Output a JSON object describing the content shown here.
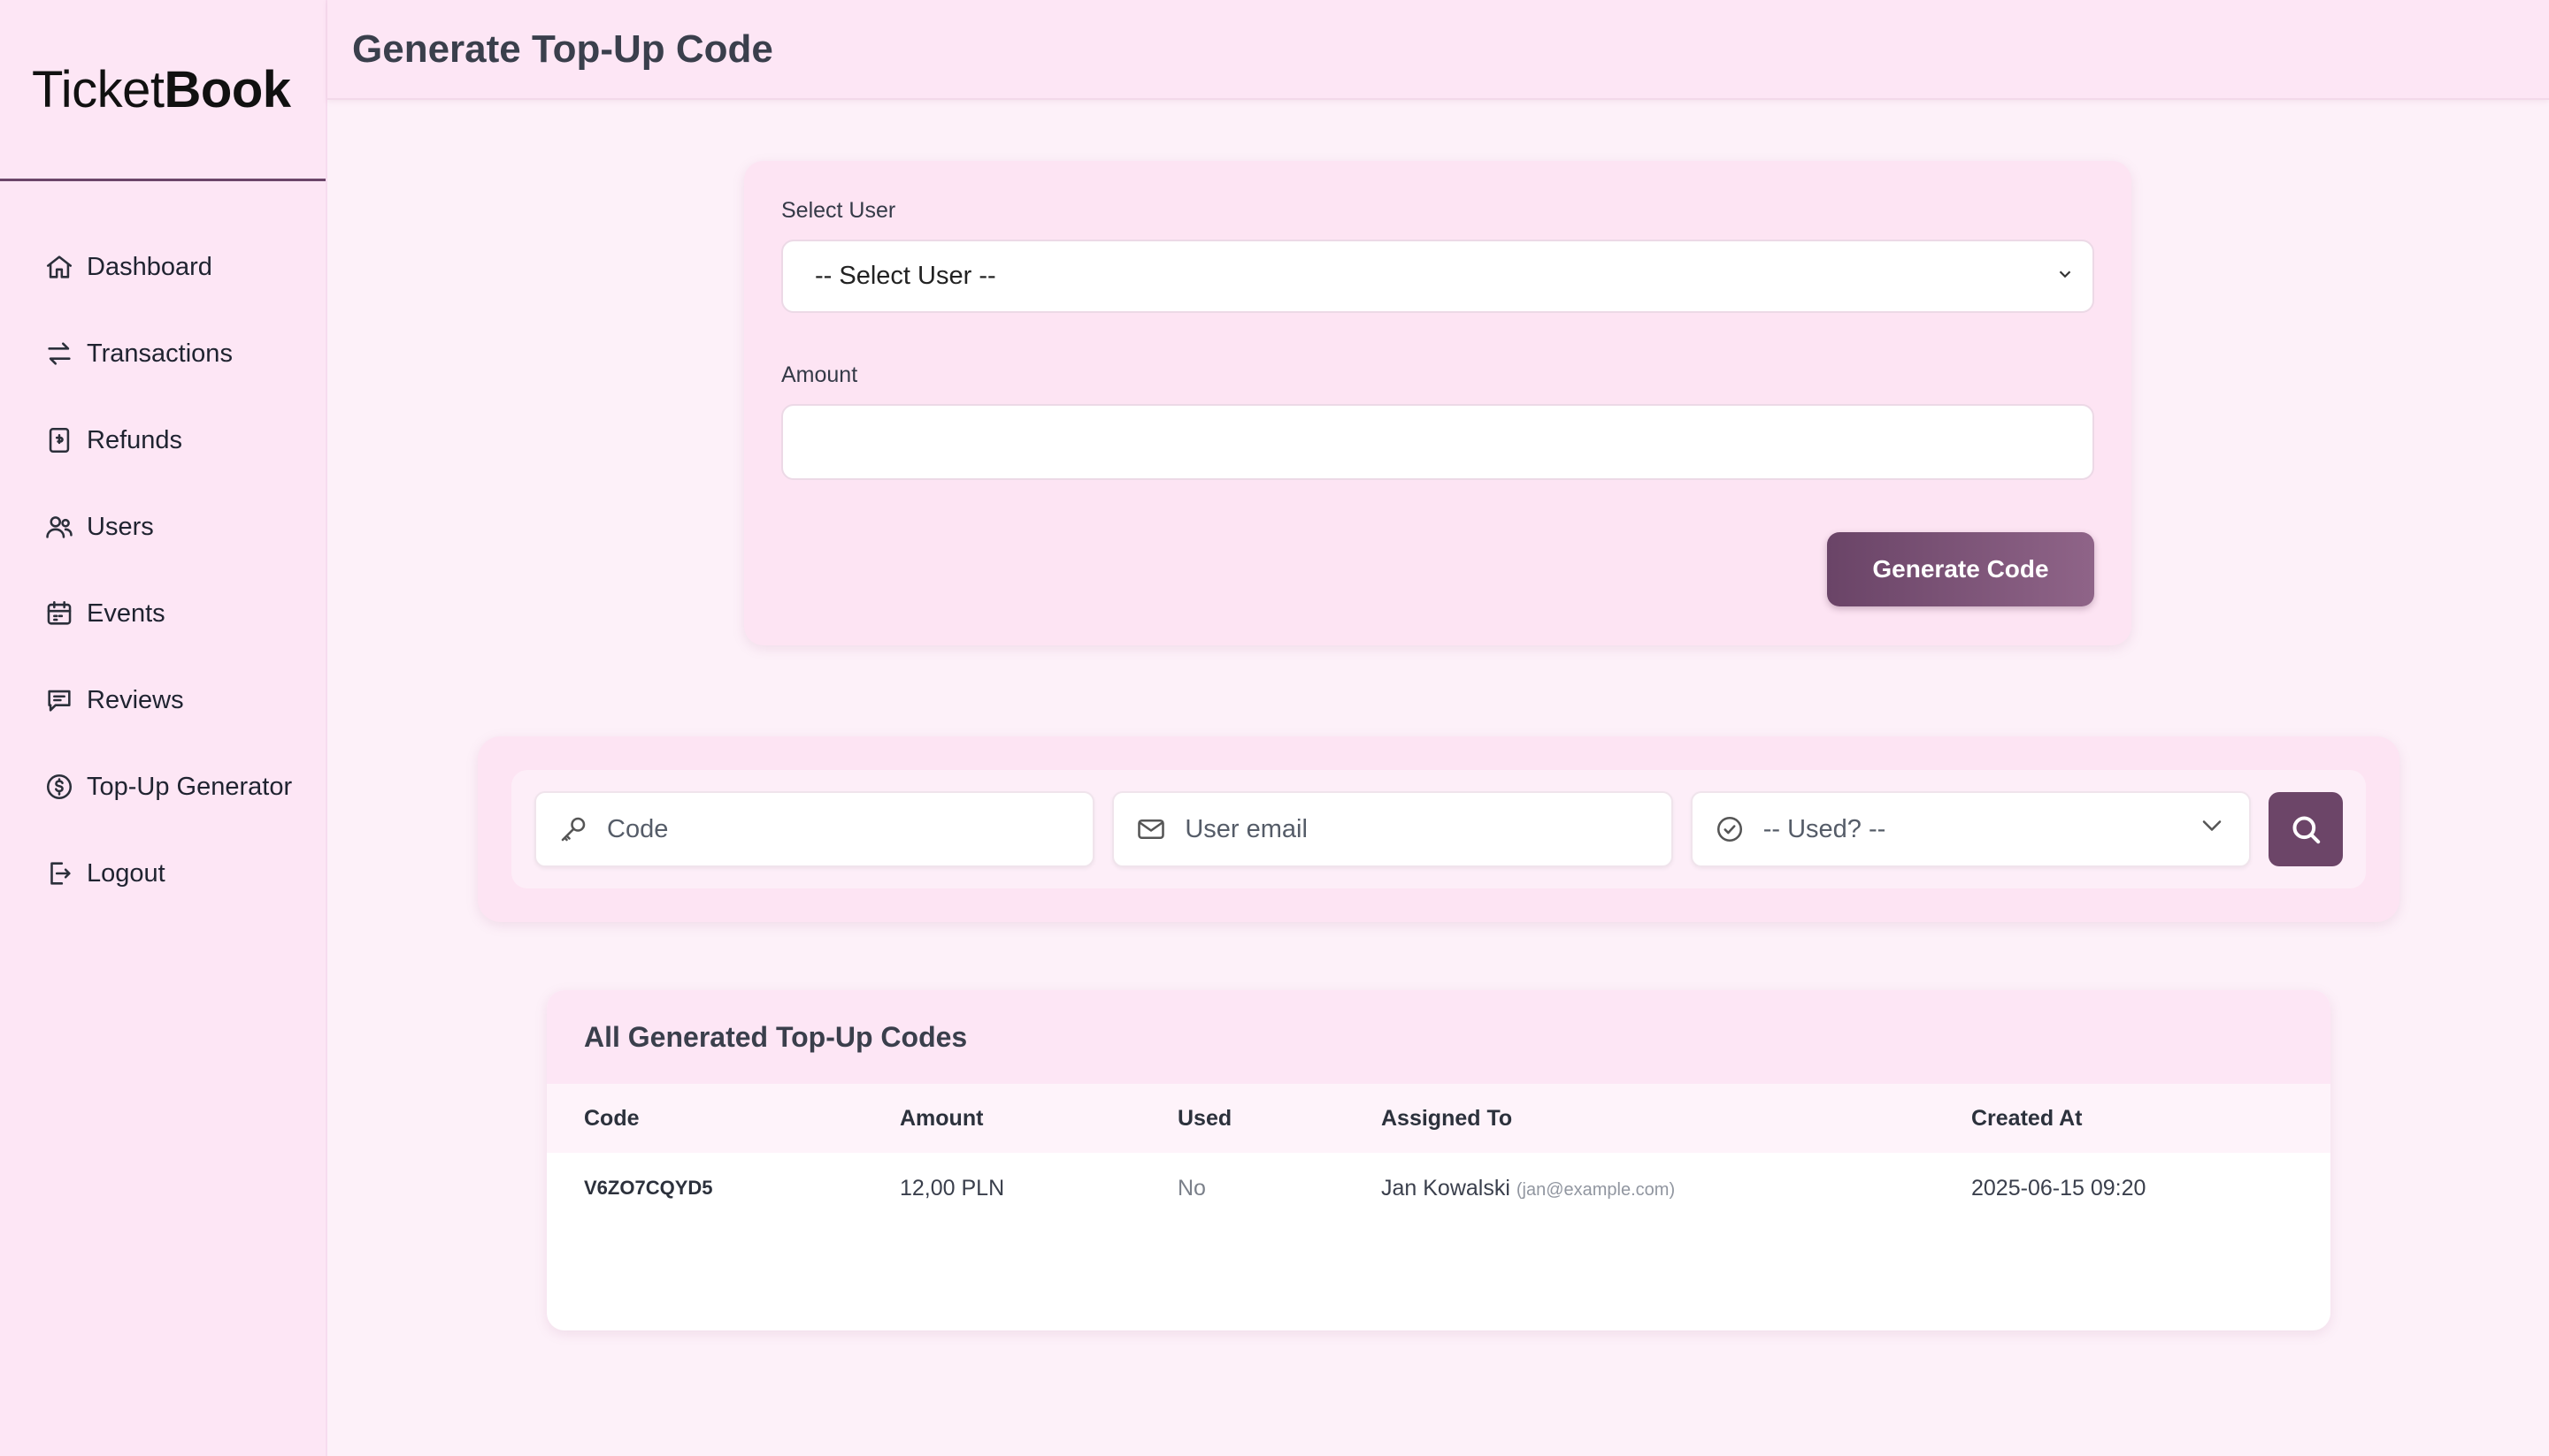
{
  "brand": {
    "light": "Ticket",
    "bold": "Book"
  },
  "sidebar": {
    "items": [
      {
        "label": "Dashboard",
        "icon": "home-icon"
      },
      {
        "label": "Transactions",
        "icon": "arrows-icon"
      },
      {
        "label": "Refunds",
        "icon": "receipt-icon"
      },
      {
        "label": "Users",
        "icon": "users-icon"
      },
      {
        "label": "Events",
        "icon": "calendar-icon"
      },
      {
        "label": "Reviews",
        "icon": "chat-icon"
      },
      {
        "label": "Top-Up Generator",
        "icon": "dollar-icon"
      },
      {
        "label": "Logout",
        "icon": "logout-icon"
      }
    ]
  },
  "header": {
    "title": "Generate Top-Up Code"
  },
  "form": {
    "user_label": "Select User",
    "user_value": "-- Select User --",
    "amount_label": "Amount",
    "amount_value": "",
    "generate_label": "Generate Code"
  },
  "filters": {
    "code_placeholder": "Code",
    "email_placeholder": "User email",
    "used_value": "-- Used? --"
  },
  "table": {
    "title": "All Generated Top-Up Codes",
    "columns": [
      "Code",
      "Amount",
      "Used",
      "Assigned To",
      "Created At"
    ],
    "rows": [
      {
        "code": "V6ZO7CQYD5",
        "amount": "12,00 PLN",
        "used": "No",
        "assigned_name": "Jan Kowalski",
        "assigned_email": "(jan@example.com)",
        "created_at": "2025-06-15 09:20"
      }
    ]
  },
  "colors": {
    "accent": "#6b4569",
    "background": "#fdf1f9",
    "panel": "#fde6f5"
  }
}
